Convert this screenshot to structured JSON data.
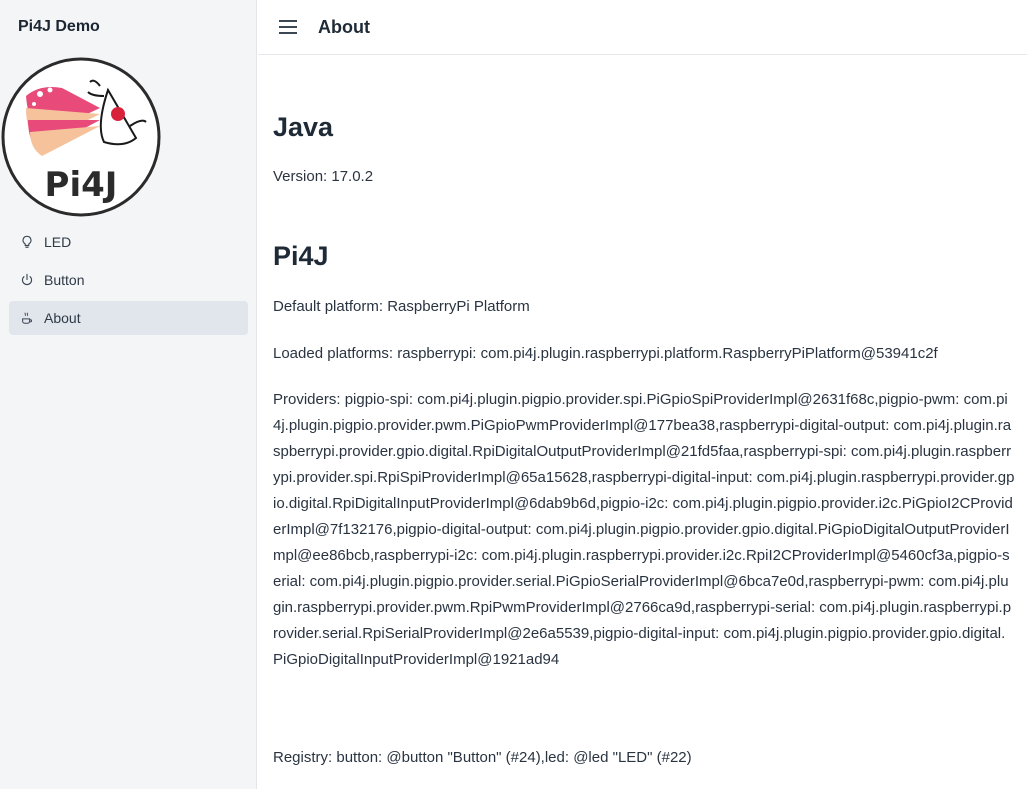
{
  "app": {
    "title": "Pi4J Demo",
    "logo_text": "Pi4J"
  },
  "sidebar": {
    "items": [
      {
        "label": "LED",
        "icon": "lightbulb-icon",
        "active": false
      },
      {
        "label": "Button",
        "icon": "power-icon",
        "active": false
      },
      {
        "label": "About",
        "icon": "coffee-icon",
        "active": true
      }
    ]
  },
  "header": {
    "title": "About",
    "menu_icon": "hamburger-menu-icon"
  },
  "main": {
    "java_heading": "Java",
    "version_text": "Version: 17.0.2",
    "pi4j_heading": "Pi4J",
    "default_platform": "Default platform: RaspberryPi Platform",
    "loaded_platforms": "Loaded platforms: raspberrypi: com.pi4j.plugin.raspberrypi.platform.RaspberryPiPlatform@53941c2f",
    "providers": "Providers: pigpio-spi: com.pi4j.plugin.pigpio.provider.spi.PiGpioSpiProviderImpl@2631f68c,pigpio-pwm: com.pi4j.plugin.pigpio.provider.pwm.PiGpioPwmProviderImpl@177bea38,raspberrypi-digital-output: com.pi4j.plugin.raspberrypi.provider.gpio.digital.RpiDigitalOutputProviderImpl@21fd5faa,raspberrypi-spi: com.pi4j.plugin.raspberrypi.provider.spi.RpiSpiProviderImpl@65a15628,raspberrypi-digital-input: com.pi4j.plugin.raspberrypi.provider.gpio.digital.RpiDigitalInputProviderImpl@6dab9b6d,pigpio-i2c: com.pi4j.plugin.pigpio.provider.i2c.PiGpioI2CProviderImpl@7f132176,pigpio-digital-output: com.pi4j.plugin.pigpio.provider.gpio.digital.PiGpioDigitalOutputProviderImpl@ee86bcb,raspberrypi-i2c: com.pi4j.plugin.raspberrypi.provider.i2c.RpiI2CProviderImpl@5460cf3a,pigpio-serial: com.pi4j.plugin.pigpio.provider.serial.PiGpioSerialProviderImpl@6bca7e0d,raspberrypi-pwm: com.pi4j.plugin.raspberrypi.provider.pwm.RpiPwmProviderImpl@2766ca9d,raspberrypi-serial: com.pi4j.plugin.raspberrypi.provider.serial.RpiSerialProviderImpl@2e6a5539,pigpio-digital-input: com.pi4j.plugin.pigpio.provider.gpio.digital.PiGpioDigitalInputProviderImpl@1921ad94",
    "registry": "Registry: button: @button \"Button\" (#24),led: @led \"LED\" (#22)"
  },
  "colors": {
    "sidebar_bg": "#f4f5f7",
    "active_item_bg": "#e1e5ec",
    "text": "#1f2a37",
    "logo_pink": "#e84a7a",
    "logo_peach": "#f6c29b"
  }
}
